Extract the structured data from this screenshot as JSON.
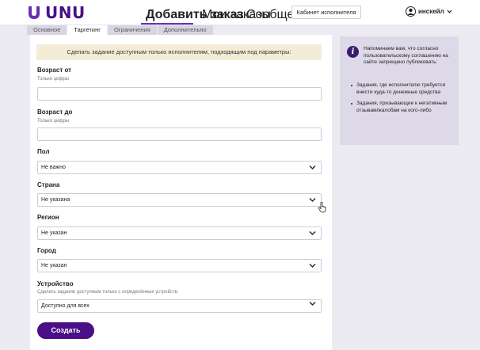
{
  "header": {
    "logo_text": "UNU",
    "nav": [
      "Добавить заказ",
      "Мои заказы",
      "Сообщения"
    ],
    "cabinet_label": "Кабинет исполнителя",
    "user_name": "инскейл"
  },
  "tabs": [
    "Основное",
    "Таргетинг",
    "Ограничения",
    "Дополнительно"
  ],
  "active_tab": "Таргетинг",
  "form": {
    "notice": "Сделать задание доступным только исполнителям, подходящим под параметры:",
    "age_from": {
      "label": "Возраст от",
      "hint": "Только цифры",
      "value": ""
    },
    "age_to": {
      "label": "Возраст до",
      "hint": "Только цифры",
      "value": ""
    },
    "gender": {
      "label": "Пол",
      "value": "Не важно"
    },
    "country": {
      "label": "Страна",
      "value": "Не указана"
    },
    "region": {
      "label": "Регион",
      "value": "Не указан"
    },
    "city": {
      "label": "Город",
      "value": "Не указан"
    },
    "device": {
      "label": "Устройство",
      "hint": "Сделать задание доступным только с определённых устройств.",
      "value": "Доступно для всех"
    },
    "submit_label": "Создать"
  },
  "info": {
    "intro": "Напоминаем вам, что согласно пользовательскому соглашению на сайте запрещено публиковать:",
    "items": [
      "Задания, где исполнителю требуется внести куда-то денежные средства",
      "Задания, призывающие к негативным отзывам/жалобам на кого-либо"
    ]
  },
  "colors": {
    "brand": "#4a0f86",
    "notice_bg": "#f3ecd6",
    "info_bg": "#ded9e8"
  }
}
